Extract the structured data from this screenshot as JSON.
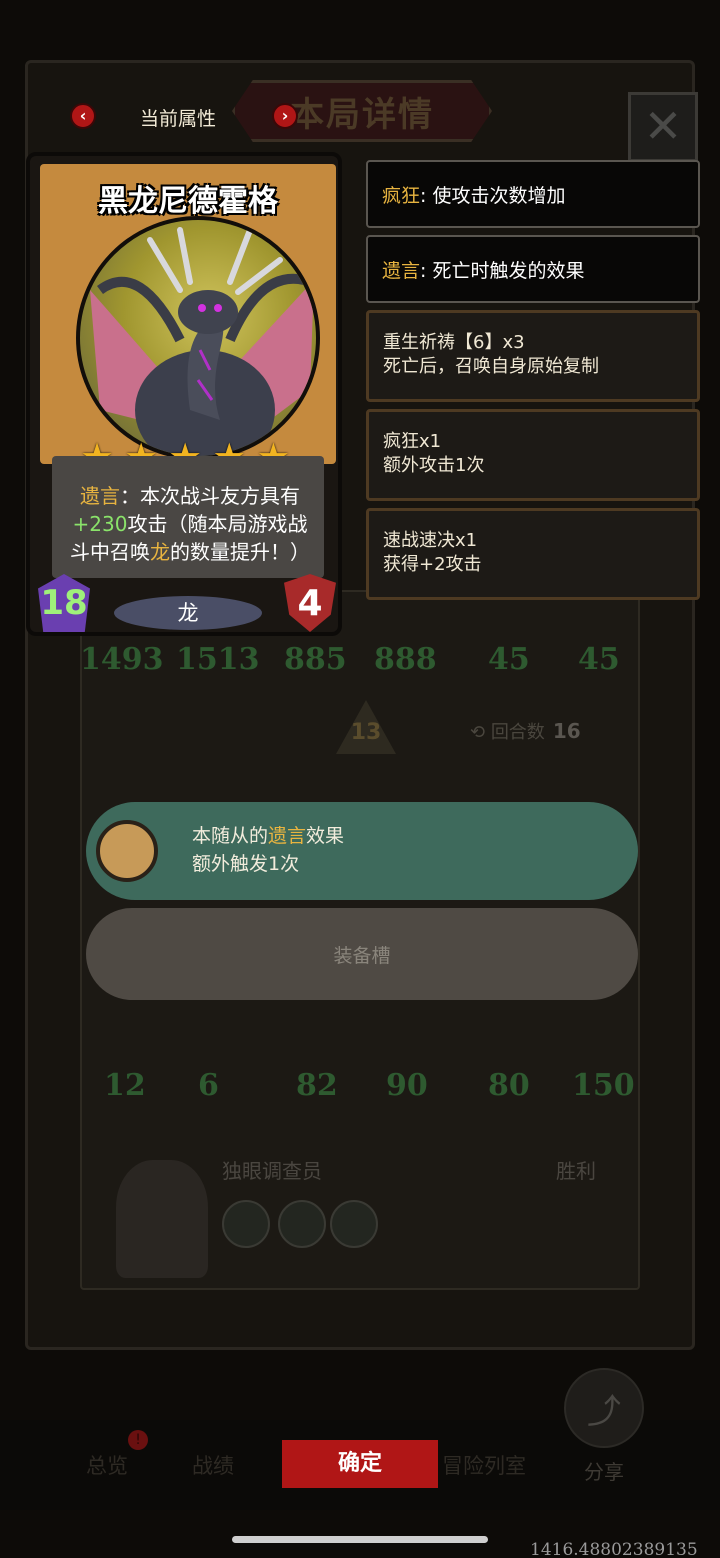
{
  "header": {
    "title": "本局详情",
    "attr_label": "当前属性",
    "prev_icon": "chevron-left-icon",
    "next_icon": "chevron-right-icon",
    "close_glyph": "✕"
  },
  "card": {
    "name": "黑龙尼德霍格",
    "stars": 5,
    "deathrattle_kw": "遗言",
    "desc_part1": "：本次战斗友方具有",
    "bonus": "+230",
    "desc_part2": "攻击（随本局游戏战斗中召唤",
    "desc_race_kw": "龙",
    "desc_part3": "的数量提升！）",
    "tier": "18",
    "race": "龙",
    "health": "4"
  },
  "keywords": [
    {
      "key": "疯狂",
      "text": ": 使攻击次数增加"
    },
    {
      "key": "遗言",
      "text": ": 死亡时触发的效果"
    }
  ],
  "effects": [
    {
      "title": "重生祈祷【6】x3",
      "detail": "死亡后，召唤自身原始复制"
    },
    {
      "title": "疯狂x1",
      "detail": "额外攻击1次"
    },
    {
      "title": "速战速决x1",
      "detail": "获得+2攻击"
    }
  ],
  "background_stats": {
    "row1": [
      "1493",
      "1513",
      "885",
      "888",
      "45",
      "45"
    ],
    "row2": [
      "12",
      "6",
      "82",
      "90",
      "80",
      "150"
    ],
    "arrow_value": "13",
    "round_label": "回合数",
    "round_value": "16"
  },
  "tooltip": {
    "line1_prefix": "本随从的",
    "line1_kw": "遗言",
    "line1_suffix": "效果",
    "line2": "额外触发1次"
  },
  "equip_slot_label": "装备槽",
  "player": {
    "name": "独眼调查员",
    "result": "胜利"
  },
  "nav": {
    "overview": "总览",
    "record": "战绩",
    "confirm": "确定",
    "gallery": "冒险列室",
    "share": "分享"
  },
  "coords_text": "1416.48802389135"
}
